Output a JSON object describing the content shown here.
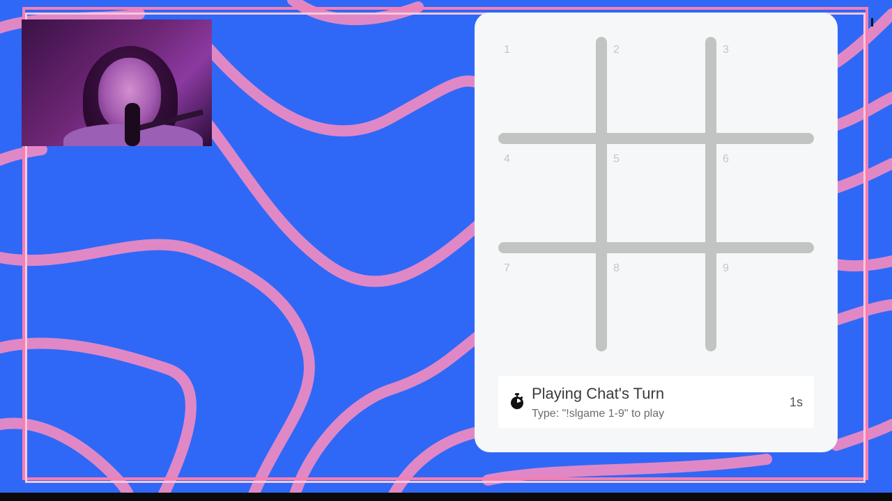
{
  "board": {
    "cells": [
      "1",
      "2",
      "3",
      "4",
      "5",
      "6",
      "7",
      "8",
      "9"
    ]
  },
  "turn": {
    "icon": "stopwatch-icon",
    "title": "Playing Chat's Turn",
    "instruction": "Type: \"!slgame 1-9\" to play",
    "time_remaining": "1s"
  },
  "colors": {
    "background": "#2f68f7",
    "wave": "#f48cc0",
    "panel": "#f5f7f8",
    "grid_lines": "#c2c4c3"
  }
}
